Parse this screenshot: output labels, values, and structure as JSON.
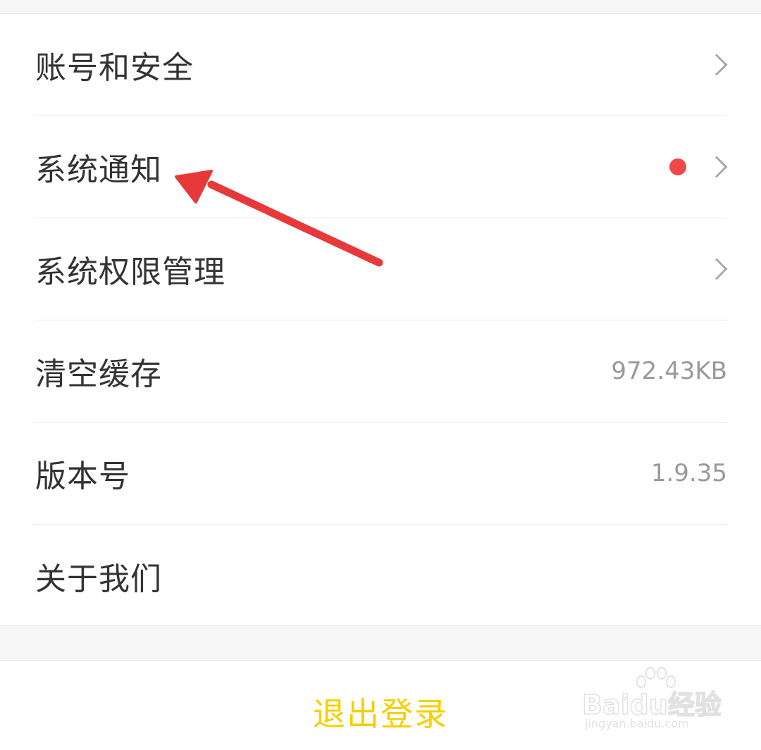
{
  "settings": {
    "items": [
      {
        "label": "账号和安全",
        "value": "",
        "badge": false,
        "chevron": true
      },
      {
        "label": "系统通知",
        "value": "",
        "badge": true,
        "chevron": true
      },
      {
        "label": "系统权限管理",
        "value": "",
        "badge": false,
        "chevron": true
      },
      {
        "label": "清空缓存",
        "value": "972.43KB",
        "badge": false,
        "chevron": false
      },
      {
        "label": "版本号",
        "value": "1.9.35",
        "badge": false,
        "chevron": false
      },
      {
        "label": "关于我们",
        "value": "",
        "badge": false,
        "chevron": false
      }
    ]
  },
  "logout": {
    "label": "退出登录"
  },
  "colors": {
    "accent": "#f5d000",
    "badge": "#f04848",
    "annotation_arrow": "#e8393a",
    "text": "#333333",
    "secondary_text": "#999999"
  },
  "icons": {
    "chevron": "chevron-right-icon",
    "badge": "notification-dot-icon",
    "annotation": "red-arrow-annotation",
    "watermark": "baidu-jingyan-logo"
  },
  "watermark": {
    "brand": "Baidu经验",
    "url": "jingyan.baidu.com"
  }
}
